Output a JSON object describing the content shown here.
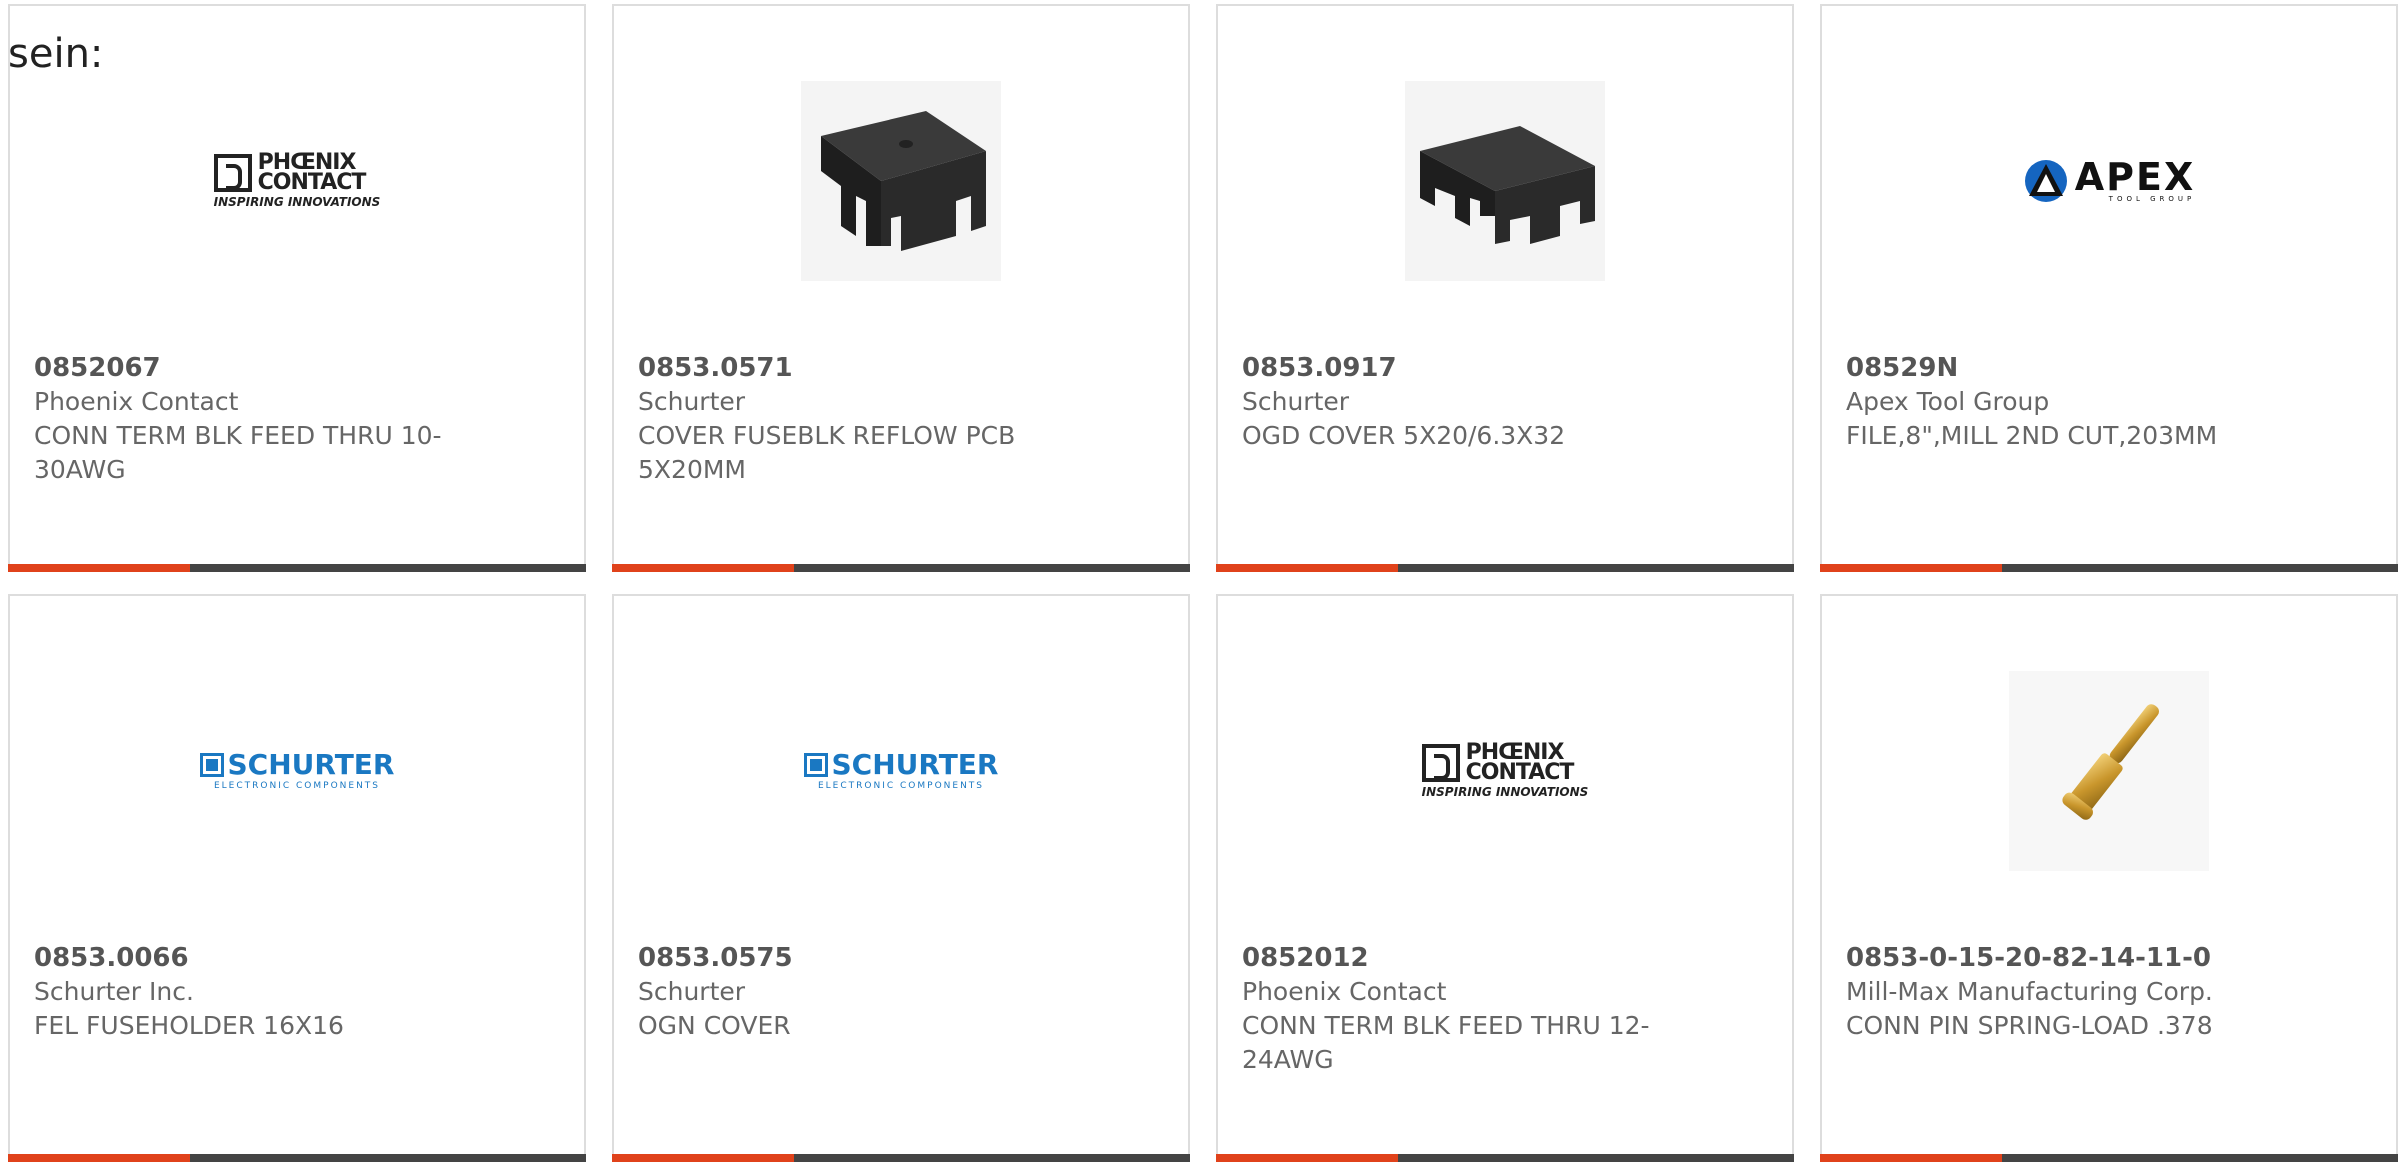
{
  "heading": "sein:",
  "products": [
    {
      "part": "0852067",
      "manufacturer": "Phoenix Contact",
      "description": "CONN TERM BLK FEED THRU 10-30AWG",
      "image": "phoenix-contact-logo",
      "logo_line1": "PHŒNIX",
      "logo_line2": "CONTACT",
      "logo_tag": "INSPIRING INNOVATIONS"
    },
    {
      "part": "0853.0571",
      "manufacturer": "Schurter",
      "description": "COVER FUSEBLK REFLOW PCB 5X20MM",
      "image": "fuse-cover-photo"
    },
    {
      "part": "0853.0917",
      "manufacturer": "Schurter",
      "description": "OGD COVER 5X20/6.3X32",
      "image": "fuse-cover-photo-2"
    },
    {
      "part": "08529N",
      "manufacturer": "Apex Tool Group",
      "description": "FILE,8\",MILL 2ND CUT,203MM",
      "image": "apex-logo",
      "logo_line1": "APEX",
      "logo_tag": "TOOL GROUP"
    },
    {
      "part": "0853.0066",
      "manufacturer": "Schurter Inc.",
      "description": "FEL FUSEHOLDER 16X16",
      "image": "schurter-logo",
      "logo_line1": "SCHURTER",
      "logo_tag": "ELECTRONIC COMPONENTS"
    },
    {
      "part": "0853.0575",
      "manufacturer": "Schurter",
      "description": "OGN COVER",
      "image": "schurter-logo",
      "logo_line1": "SCHURTER",
      "logo_tag": "ELECTRONIC COMPONENTS"
    },
    {
      "part": "0852012",
      "manufacturer": "Phoenix Contact",
      "description": "CONN TERM BLK FEED THRU 12-24AWG",
      "image": "phoenix-contact-logo",
      "logo_line1": "PHŒNIX",
      "logo_line2": "CONTACT",
      "logo_tag": "INSPIRING INNOVATIONS"
    },
    {
      "part": "0853-0-15-20-82-14-11-0",
      "manufacturer": "Mill-Max Manufacturing Corp.",
      "description": "CONN PIN SPRING-LOAD .378",
      "image": "spring-pin-photo"
    }
  ],
  "colors": {
    "accent": "#e0421b",
    "bar": "#444444",
    "border": "#dddddd",
    "schurter_blue": "#1a78c2"
  }
}
